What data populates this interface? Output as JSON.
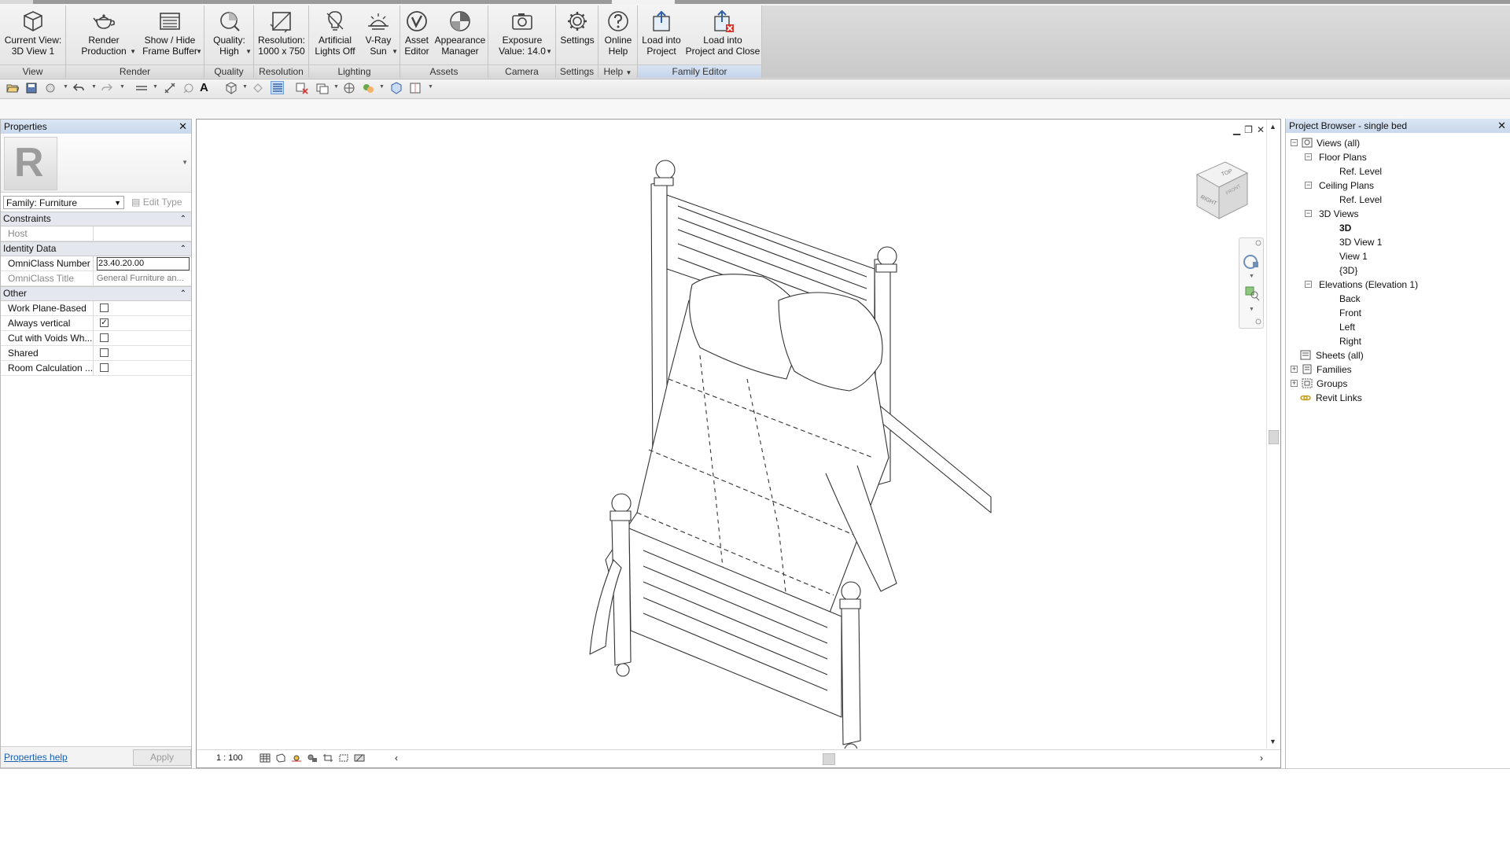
{
  "ribbon": {
    "panels": [
      {
        "title": "View",
        "buttons": [
          {
            "label": "Current View:\n3D View 1",
            "icon": "cube-view-icon"
          }
        ]
      },
      {
        "title": "Render",
        "buttons": [
          {
            "label": "Render\nProduction",
            "icon": "teapot-icon"
          },
          {
            "label": "Show / Hide\nFrame Buffer",
            "icon": "frame-buffer-icon"
          }
        ]
      },
      {
        "title": "Quality",
        "buttons": [
          {
            "label": "Quality:\nHigh",
            "icon": "quality-icon"
          }
        ]
      },
      {
        "title": "Resolution",
        "buttons": [
          {
            "label": "Resolution:\n1000 x 750",
            "icon": "resolution-icon"
          }
        ]
      },
      {
        "title": "Lighting",
        "buttons": [
          {
            "label": "Artificial\nLights Off",
            "icon": "bulb-icon"
          },
          {
            "label": "V-Ray\nSun",
            "icon": "sun-icon"
          }
        ]
      },
      {
        "title": "Assets",
        "buttons": [
          {
            "label": "Asset\nEditor",
            "icon": "vray-logo-icon"
          },
          {
            "label": "Appearance\nManager",
            "icon": "appearance-icon"
          }
        ]
      },
      {
        "title": "Camera",
        "buttons": [
          {
            "label": "Exposure\nValue: 14.0",
            "icon": "camera-icon"
          }
        ]
      },
      {
        "title": "Settings",
        "buttons": [
          {
            "label": "Settings",
            "icon": "gear-icon"
          }
        ]
      },
      {
        "title": "Help",
        "buttons": [
          {
            "label": "Online\nHelp",
            "icon": "help-icon"
          }
        ]
      },
      {
        "title": "Family Editor",
        "buttons": [
          {
            "label": "Load into\nProject",
            "icon": "load-project-icon"
          },
          {
            "label": "Load into\nProject and Close",
            "icon": "load-close-icon"
          }
        ]
      }
    ]
  },
  "properties": {
    "title": "Properties",
    "family_select": "Family: Furniture",
    "edit_type": "Edit Type",
    "groups": {
      "constraints": "Constraints",
      "identity": "Identity Data",
      "other": "Other"
    },
    "rows": {
      "host": {
        "name": "Host",
        "value": ""
      },
      "omniclass_number": {
        "name": "OmniClass Number",
        "value": "23.40.20.00"
      },
      "omniclass_title": {
        "name": "OmniClass Title",
        "value": "General Furniture an..."
      },
      "work_plane": {
        "name": "Work Plane-Based",
        "checked": false
      },
      "always_vertical": {
        "name": "Always vertical",
        "checked": true
      },
      "cut_voids": {
        "name": "Cut with Voids Wh...",
        "checked": false
      },
      "shared": {
        "name": "Shared",
        "checked": false
      },
      "room_calc": {
        "name": "Room Calculation ...",
        "checked": false
      }
    },
    "help_link": "Properties help",
    "apply": "Apply"
  },
  "view": {
    "scale": "1 : 100",
    "viewcube": {
      "top": "TOP",
      "right": "RIGHT",
      "front": "FRONT"
    }
  },
  "browser": {
    "title": "Project Browser - single bed",
    "items": [
      "Views (all)",
      "Floor Plans",
      "Ref. Level",
      "Ceiling Plans",
      "Ref. Level",
      "3D Views",
      "3D",
      "3D View 1",
      "View 1",
      "{3D}",
      "Elevations (Elevation 1)",
      "Back",
      "Front",
      "Left",
      "Right",
      "Sheets (all)",
      "Families",
      "Groups",
      "Revit Links"
    ]
  },
  "colors": {
    "accent": "#c9dcf4",
    "link": "#1a5fb4"
  }
}
